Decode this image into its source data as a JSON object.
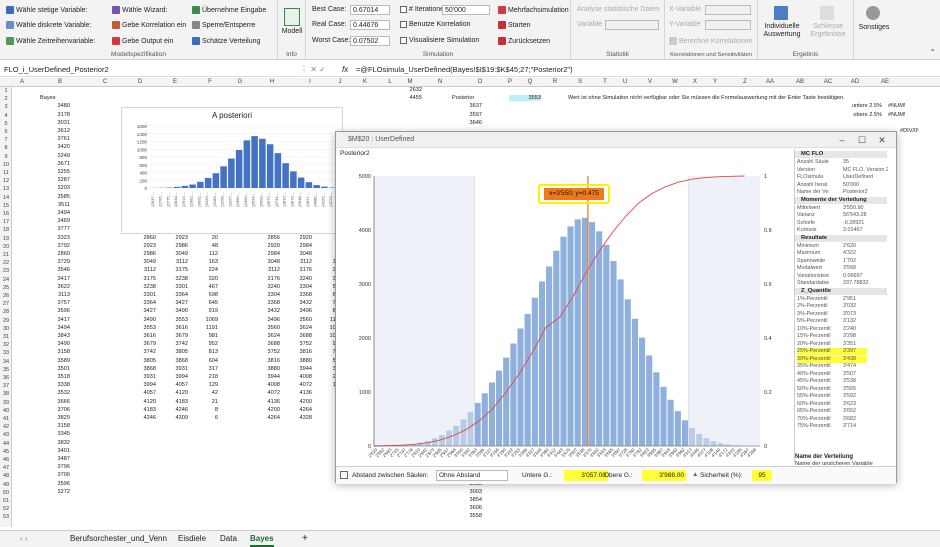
{
  "ribbon": {
    "group1": {
      "items": [
        "Wähle stetige Variable:",
        "Wähle diskrete Variable:",
        "Wähle Zeitreihenvariable:",
        "Wähle Wizard:",
        "Gebe Korrelation ein",
        "Gebe Output ein",
        "Übernehme Eingabe",
        "Sperre/Entsperre",
        "Schätze Verteilung"
      ],
      "title": "Modellspezifikation"
    },
    "info": {
      "label": "Modell",
      "title": "Info"
    },
    "simulation": {
      "best_label": "Best Case:",
      "best_value": "0.67014",
      "real_label": "Real Case:",
      "real_value": "0.44676",
      "worst_label": "Worst Case:",
      "worst_value": "0.07502",
      "iter_label": "# Iterationen:",
      "iter_value": "50'000",
      "opt1": "Benutze Korrelation",
      "opt2": "Visualisiere Simulation",
      "multi": "Mehrfachsimulation",
      "start": "Starten",
      "reset": "Zurücksetzen",
      "title": "Simulation"
    },
    "statistik": {
      "l1": "Analyse statistische Daten",
      "l2": "Variable",
      "title": "Statistik"
    },
    "korr": {
      "x": "X-Variable",
      "y": "Y-Variable",
      "calc": "Berechne Korrelationen",
      "title": "Korrelationen und Sensitivitäten"
    },
    "ergebnis": {
      "ind": "Individuelle Auswertung",
      "close": "Schliesse Ergebnisse",
      "title": "Ergebnis"
    },
    "sonstiges": {
      "label": "Sonstiges"
    }
  },
  "formula_bar": {
    "name_box": "FLO_i_UserDefined_Posterior2",
    "fx": "fx",
    "formula": "=@FLOsimula_UserDefined(Bayes!$I$19:$K$45;27;\"Posterior2\")"
  },
  "columns": [
    "A",
    "B",
    "C",
    "D",
    "E",
    "F",
    "G",
    "H",
    "I",
    "J",
    "K",
    "L",
    "M",
    "N",
    "O",
    "P",
    "Q",
    "R",
    "S",
    "T",
    "U",
    "V",
    "W",
    "X",
    "Y",
    "Z",
    "AA",
    "AB",
    "AC",
    "AD",
    "AE"
  ],
  "rows": [
    "1",
    "2",
    "3",
    "4",
    "5",
    "6",
    "7",
    "8",
    "9",
    "10",
    "11",
    "12",
    "13",
    "14",
    "15",
    "16",
    "17",
    "18",
    "19",
    "20",
    "21",
    "22",
    "23",
    "24",
    "25",
    "26",
    "27",
    "28",
    "29",
    "30",
    "31",
    "32",
    "33",
    "34",
    "35",
    "36",
    "37",
    "38",
    "39",
    "40",
    "41",
    "42",
    "43",
    "44",
    "45",
    "46",
    "47",
    "48",
    "49",
    "50",
    "51",
    "52",
    "53"
  ],
  "sheet": {
    "b_header": "Bayes",
    "col_b": [
      "3480",
      "3178",
      "3031",
      "3612",
      "3761",
      "3420",
      "3249",
      "3671",
      "3255",
      "3287",
      "3293",
      "3585",
      "3511",
      "3494",
      "3469",
      "3777",
      "3323",
      "3792",
      "2860",
      "3729",
      "3546",
      "3417",
      "3622",
      "3113",
      "3757",
      "3596",
      "3417",
      "3494",
      "3843",
      "3490",
      "3158",
      "3589",
      "3501",
      "3518",
      "3338",
      "3532",
      "3666",
      "3706",
      "3829",
      "3158",
      "3345",
      "3832",
      "3401",
      "3487",
      "3796",
      "3706",
      "3596",
      "3272"
    ],
    "col_f": [
      "2608",
      "2671",
      "2734",
      "2797",
      "2860",
      "2923",
      "2986",
      "3049",
      "3112",
      "3175",
      "3238",
      "3301",
      "3364",
      "3427",
      "3490",
      "3553",
      "3616",
      "3679",
      "3742",
      "3805",
      "3868",
      "3931",
      "3994",
      "4057",
      "4120",
      "4183",
      "4246"
    ],
    "col_g": [
      "2671",
      "2734",
      "2797",
      "2860",
      "2923",
      "2986",
      "3049",
      "3112",
      "3175",
      "3238",
      "3301",
      "3364",
      "3427",
      "3490",
      "3553",
      "3616",
      "3679",
      "3742",
      "3805",
      "3868",
      "3931",
      "3994",
      "4057",
      "4120",
      "4183",
      "4246",
      "4309"
    ],
    "col_h": [
      "2",
      "2",
      "7",
      "22",
      "20",
      "48",
      "112",
      "163",
      "224",
      "320",
      "467",
      "698",
      "645",
      "919",
      "1069",
      "1191",
      "981",
      "952",
      "813",
      "604",
      "317",
      "218",
      "129",
      "42",
      "21",
      "8",
      "6"
    ],
    "col_j": [
      "2600",
      "2664",
      "2728",
      "2792",
      "2856",
      "2920",
      "2984",
      "3048",
      "3112",
      "3176",
      "3240",
      "3304",
      "3368",
      "3432",
      "3496",
      "3560",
      "3624",
      "3688",
      "3752",
      "3816",
      "3880",
      "3944",
      "4008",
      "4072",
      "4136",
      "4200",
      "4264"
    ],
    "col_k": [
      "2664",
      "2728",
      "2792",
      "2856",
      "2920",
      "2984",
      "3048",
      "3112",
      "3176",
      "3240",
      "3304",
      "3368",
      "3432",
      "3496",
      "3560",
      "3624",
      "3688",
      "3752",
      "3816",
      "3880",
      "3944",
      "4008",
      "4072",
      "4136",
      "4200",
      "4264",
      "4328"
    ],
    "col_l": [
      "1",
      "5",
      "6",
      "29",
      "38",
      "55",
      "99",
      "195",
      "271",
      "318",
      "551",
      "609",
      "743",
      "891",
      "1107",
      "1074",
      "1072",
      "921",
      "727",
      "539",
      "349",
      "215",
      "136",
      "65",
      "13",
      "0",
      "1"
    ],
    "n_top": [
      "2632",
      "4455"
    ],
    "o_label": "Posterior",
    "p_value": "3553",
    "o_col": [
      "3637",
      "3597",
      "3646"
    ],
    "o_bottom": [
      "3663",
      "3003",
      "3854",
      "3606",
      "3558"
    ],
    "message": "Wert ist ohne Simulation nicht verfügbar oder Sie müssen die Formelauswertung mit der Enter Taste bestätigen.",
    "untere": "untere 2.5%",
    "obere": "obere 2.5%",
    "num1": "#NUM!",
    "num2": "#NUM!",
    "div": "#DIV/0!"
  },
  "small_chart": {
    "title": "A posteriori",
    "yticks": [
      "1600",
      "1400",
      "1200",
      "1000",
      "800",
      "600",
      "400",
      "200",
      "0"
    ],
    "xlabels": [
      "[2637;...",
      "[2706;...",
      "[2775;...",
      "[2844;...",
      "[2913;...",
      "[2982;...",
      "[3051;...",
      "[3120;...",
      "[3189;...",
      "[3258;...",
      "[3327;...",
      "[3396;...",
      "[3465;...",
      "[3534;...",
      "[3603;...",
      "[3672;...",
      "[3741;...",
      "[3810;...",
      "[3879;...",
      "[3948;...",
      "[4017;...",
      "[4086;...",
      "[4155;...",
      "[4224;..."
    ],
    "chart_data": {
      "type": "bar",
      "title": "A posteriori",
      "values": [
        3,
        6,
        12,
        30,
        55,
        90,
        160,
        260,
        380,
        560,
        760,
        980,
        1230,
        1340,
        1270,
        1130,
        900,
        640,
        430,
        270,
        150,
        75,
        35,
        12
      ],
      "ylim": [
        0,
        1600
      ]
    }
  },
  "dialog": {
    "title": "$M$20 : UserDefined",
    "subtitle": "Posterior2",
    "tooltip": "x=3'550; y=0.475",
    "chart_data": {
      "type": "bar",
      "categories": [
        "2'620",
        "2'652",
        "2'683",
        "2'715",
        "2'747",
        "2'778",
        "2'810",
        "2'842",
        "2'873",
        "2'905",
        "2'937",
        "2'968",
        "3'000",
        "3'032",
        "3'063",
        "3'095",
        "3'127",
        "3'158",
        "3'190",
        "3'222",
        "3'253",
        "3'285",
        "3'317",
        "3'348",
        "3'380",
        "3'412",
        "3'443",
        "3'475",
        "3'507",
        "3'538",
        "3'570",
        "3'602",
        "3'633",
        "3'665",
        "3'697",
        "3'728",
        "3'760",
        "3'792",
        "3'823",
        "3'855",
        "3'887",
        "3'918",
        "3'950",
        "3'982",
        "4'013",
        "4'045",
        "4'077",
        "4'108",
        "4'140",
        "4'172",
        "4'203",
        "4'235",
        "4'267",
        "4'298"
      ],
      "values": [
        2,
        5,
        10,
        18,
        30,
        45,
        70,
        100,
        150,
        210,
        290,
        380,
        500,
        640,
        800,
        980,
        1180,
        1400,
        1640,
        1900,
        2180,
        2450,
        2750,
        3050,
        3330,
        3620,
        3880,
        4070,
        4200,
        4230,
        4150,
        3980,
        3730,
        3430,
        3090,
        2720,
        2360,
        2010,
        1680,
        1370,
        1100,
        860,
        650,
        480,
        340,
        230,
        150,
        95,
        58,
        34,
        19,
        10,
        5,
        2
      ],
      "series": [
        {
          "values": [
            0,
            0.001,
            0.003,
            0.006,
            0.012,
            0.022,
            0.038,
            0.062,
            0.095,
            0.14,
            0.2,
            0.27,
            0.35,
            0.44,
            0.475,
            0.55,
            0.64,
            0.72,
            0.79,
            0.85,
            0.9,
            0.935,
            0.96,
            0.977,
            0.988,
            0.994,
            0.997,
            0.999,
            1
          ]
        }
      ],
      "ylim": [
        0,
        5000
      ],
      "yticks": [
        "5000",
        "4000",
        "3000",
        "2000",
        "1000",
        "0"
      ],
      "y2ticks": [
        "1",
        "0.8",
        "0.6",
        "0.4",
        "0.2",
        "0"
      ],
      "lower_bound": 3057,
      "upper_bound": 3988,
      "marker_x": 3550
    },
    "panel": {
      "sections": [
        {
          "title": "MC FLO",
          "rows": [
            [
              "Anzahl Säule",
              "35"
            ],
            [
              "Version",
              "MC FLO, Version 2.5"
            ],
            [
              "FLOsimula",
              "UserDefined"
            ],
            [
              "Anzahl Iterat",
              "50'000"
            ],
            [
              "Name der Ve",
              "Posterior2"
            ]
          ]
        },
        {
          "title": "Momente der Verteilung",
          "rows": [
            [
              "Mittelwert",
              "3'550.90"
            ],
            [
              "Varianz",
              "56'543.28"
            ],
            [
              "Schiefe",
              "-0.28921"
            ],
            [
              "Kurtosis",
              "3.01467"
            ]
          ]
        },
        {
          "title": "Resultate",
          "rows": [
            [
              "Minimum",
              "2'620"
            ],
            [
              "Maximum",
              "4'322"
            ],
            [
              "Spannweite",
              "1'702"
            ],
            [
              "Modalwert",
              "3'568"
            ],
            [
              "Variationskoe",
              "0.06697"
            ],
            [
              "Standardabw",
              "237.78832"
            ]
          ]
        },
        {
          "title": "Z_Quantile",
          "rows": [
            [
              "1%-Perzentil",
              "2'951"
            ],
            [
              "2%-Perzentil",
              "3'032"
            ],
            [
              "3%-Perzentil",
              "3'073"
            ],
            [
              "5%-Perzentil",
              "3'132"
            ],
            [
              "10%-Perzentil",
              "3'240"
            ],
            [
              "15%-Perzentil",
              "3'298"
            ],
            [
              "20%-Perzentil",
              "3'351"
            ],
            [
              "25%-Perzentil",
              "3'397"
            ],
            [
              "30%-Perzentil",
              "3'438"
            ],
            [
              "35%-Perzentil",
              "3'474"
            ],
            [
              "40%-Perzentil",
              "3'507"
            ],
            [
              "45%-Perzentil",
              "3'538"
            ],
            [
              "50%-Perzentil",
              "3'565"
            ],
            [
              "55%-Perzentil",
              "3'592"
            ],
            [
              "60%-Perzentil",
              "3'623"
            ],
            [
              "65%-Perzentil",
              "3'652"
            ],
            [
              "70%-Perzentil",
              "3'682"
            ],
            [
              "75%-Perzentil",
              "3'714"
            ]
          ]
        }
      ],
      "desc_title": "Name der Verteilung",
      "desc_text": "Name der unsicheren Variable"
    },
    "bottom": {
      "gap_label": "Abstand zwischen Säulen:",
      "gap_value": "Ohne Abstand",
      "lower_label": "Untere G.:",
      "lower_value": "3'057.00",
      "upper_label": "Obere G.:",
      "upper_value": "3'988.00",
      "conf_label": "Sicherheit (%):",
      "conf_value": "95"
    }
  },
  "tabs": [
    "Berufsorchester_und_Venn",
    "Eisdiele",
    "Data",
    "Bayes"
  ],
  "tab_add": "+",
  "colors": {
    "bar": "#4472c4",
    "hist": "#a8bfe0",
    "cdf": "#e04848",
    "highlight": "#ffff33",
    "tooltip": "#f07a1a"
  }
}
